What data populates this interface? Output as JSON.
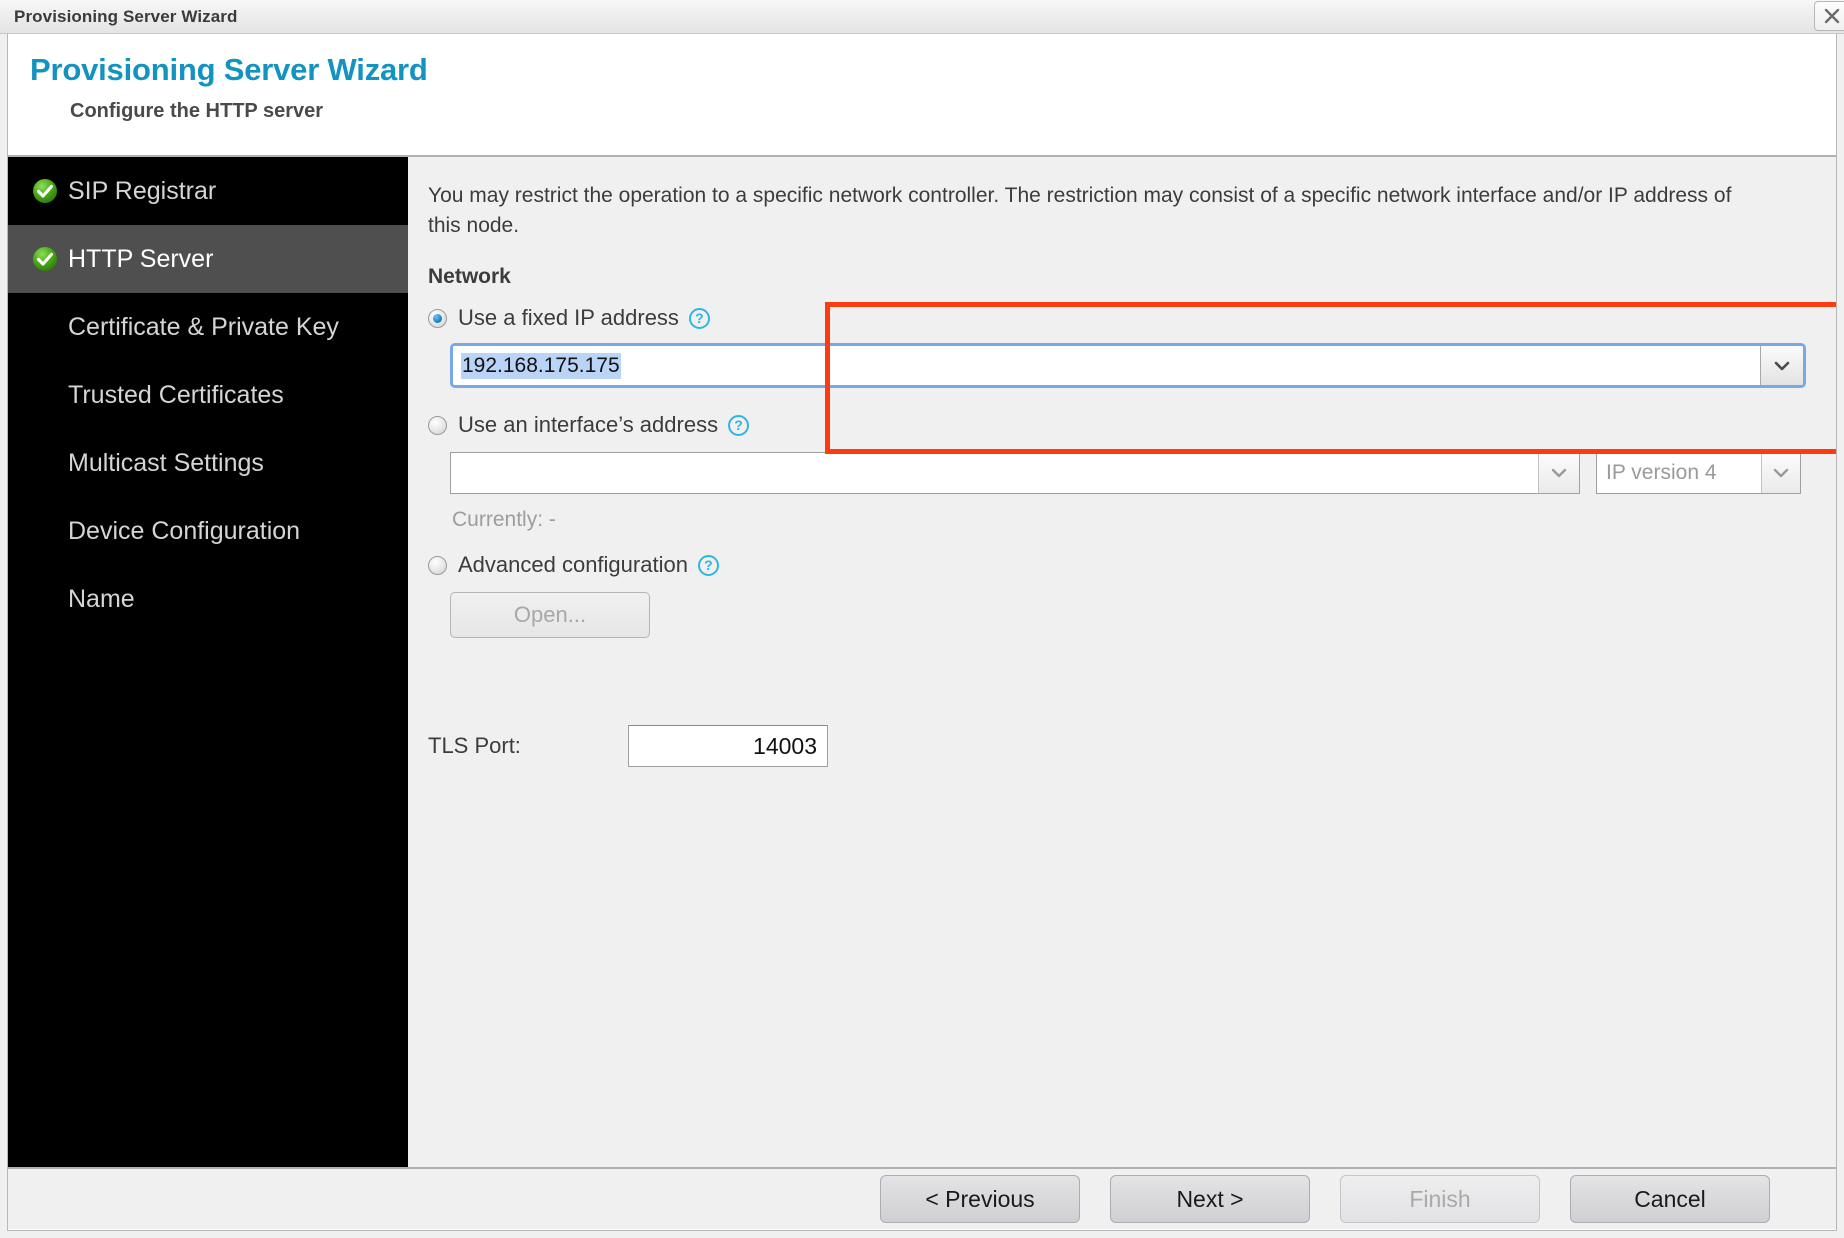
{
  "window": {
    "titlebar_text": "Provisioning Server Wizard",
    "close_icon": "close-icon"
  },
  "header": {
    "title": "Provisioning Server Wizard",
    "subtitle": "Configure the HTTP server",
    "title_color": "#1393c0"
  },
  "sidebar": {
    "items": [
      {
        "label": "SIP Registrar",
        "icon": "check-circle-icon",
        "state": "done"
      },
      {
        "label": "HTTP Server",
        "icon": "check-circle-icon",
        "state": "active"
      },
      {
        "label": "Certificate & Private Key",
        "icon": "",
        "state": "pending"
      },
      {
        "label": "Trusted Certificates",
        "icon": "",
        "state": "pending"
      },
      {
        "label": "Multicast Settings",
        "icon": "",
        "state": "pending"
      },
      {
        "label": "Device Configuration",
        "icon": "",
        "state": "pending"
      },
      {
        "label": "Name",
        "icon": "",
        "state": "pending"
      }
    ]
  },
  "main": {
    "intro": "You may restrict the operation to a specific network controller. The restriction may consist of a specific network interface and/or IP address of this node.",
    "network": {
      "group_label": "Network",
      "highlight_color": "#fc3b10",
      "fixed_ip": {
        "label": "Use a fixed IP address",
        "help_icon": "help-icon",
        "selected": true,
        "value": "192.168.175.175",
        "dropdown_icon": "chevron-down-icon"
      },
      "interface_address": {
        "label": "Use an interface’s address",
        "help_icon": "help-icon",
        "selected": false,
        "value": "",
        "dropdown_icon": "chevron-down-icon",
        "ip_version_value": "IP version 4",
        "ip_version_dropdown_icon": "chevron-down-icon",
        "currently": "Currently: -"
      },
      "advanced": {
        "label": "Advanced configuration",
        "help_icon": "help-icon",
        "selected": false,
        "open_button": "Open...",
        "open_disabled": true
      }
    },
    "tls": {
      "label": "TLS Port:",
      "value": "14003"
    }
  },
  "footer": {
    "buttons": [
      {
        "label": "< Previous",
        "disabled": false
      },
      {
        "label": "Next >",
        "disabled": false
      },
      {
        "label": "Finish",
        "disabled": true
      },
      {
        "label": "Cancel",
        "disabled": false
      }
    ]
  }
}
